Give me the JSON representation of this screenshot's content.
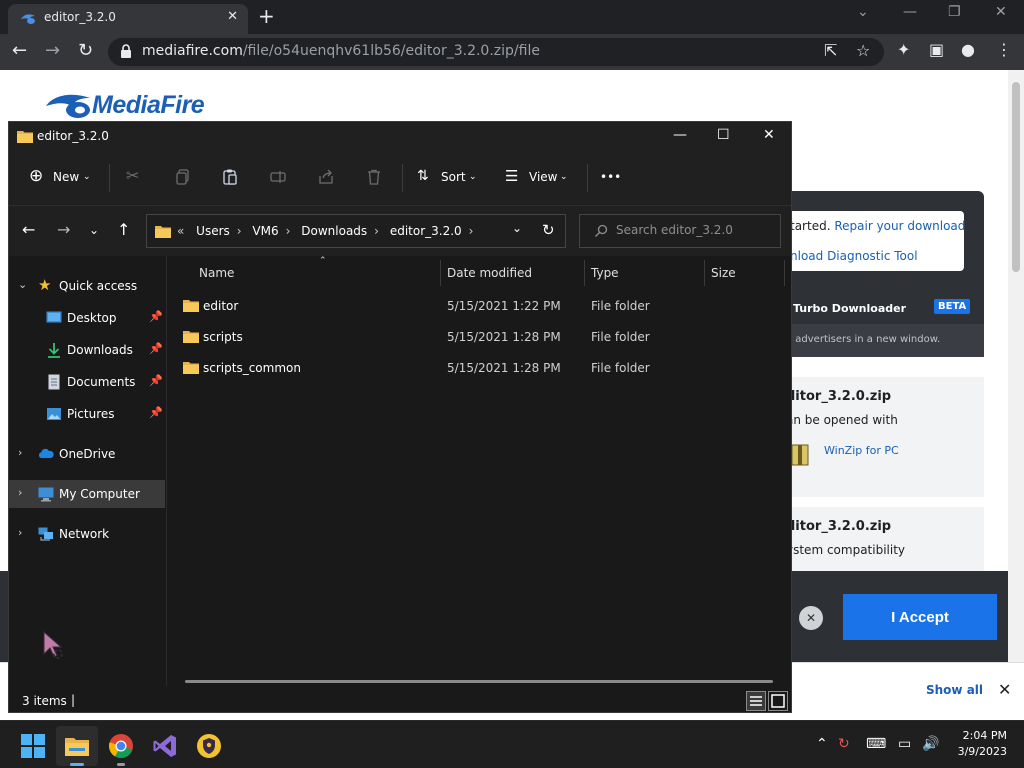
{
  "browser": {
    "tab_title": "editor_3.2.0",
    "tab_close": "✕",
    "new_tab": "+",
    "url_host": "mediafire.com",
    "url_path": "/file/o54uenqhv61lb56/editor_3.2.0.zip/file"
  },
  "webpage": {
    "logo_text": "MediaFire",
    "repair_text_start": "tarted. ",
    "repair_link": "Repair your download",
    "diagnostic_link": "nload Diagnostic Tool",
    "turbo_label": "Turbo Downloader",
    "beta_badge": "BETA",
    "advertisers_text": "r advertisers in a new window.",
    "card1_title": "ditor_3.2.0.zip",
    "card1_text": "an be opened with",
    "card1_link": "WinZip for PC",
    "card2_title": "ditor_3.2.0.zip",
    "card2_text": "ystem compatibility",
    "accept_button": "I Accept",
    "cookie_close": "✕",
    "show_all": "Show all",
    "download_bar_close": "✕"
  },
  "explorer": {
    "title": "editor_3.2.0",
    "commands": {
      "new": "New",
      "sort": "Sort",
      "view": "View",
      "more": "•••"
    },
    "breadcrumb": [
      "Users",
      "VM6",
      "Downloads",
      "editor_3.2.0"
    ],
    "breadcrumb_prefix": "«",
    "search_placeholder": "Search editor_3.2.0",
    "nav": {
      "quick_access": "Quick access",
      "desktop": "Desktop",
      "downloads": "Downloads",
      "documents": "Documents",
      "pictures": "Pictures",
      "onedrive": "OneDrive",
      "my_computer": "My Computer",
      "network": "Network"
    },
    "columns": {
      "name": "Name",
      "date_modified": "Date modified",
      "type": "Type",
      "size": "Size"
    },
    "files": [
      {
        "name": "editor",
        "date": "5/15/2021 1:22 PM",
        "type": "File folder"
      },
      {
        "name": "scripts",
        "date": "5/15/2021 1:28 PM",
        "type": "File folder"
      },
      {
        "name": "scripts_common",
        "date": "5/15/2021 1:28 PM",
        "type": "File folder"
      }
    ],
    "status_count": "3 items"
  },
  "taskbar": {
    "time": "2:04 PM",
    "date": "3/9/2023"
  }
}
